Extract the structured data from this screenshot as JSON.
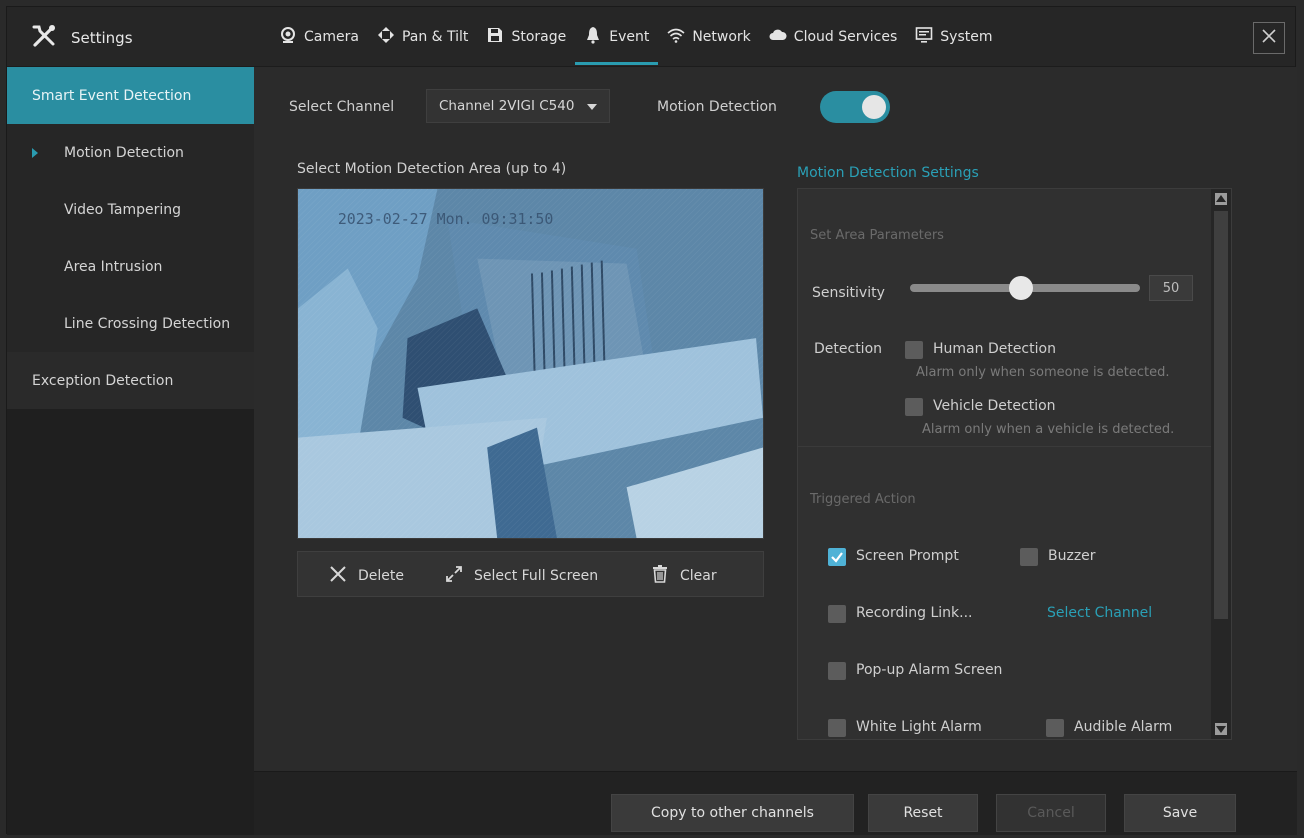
{
  "app": {
    "title": "Settings",
    "brand_icon": "tools-icon"
  },
  "tabs": [
    {
      "label": "Camera",
      "icon": "camera-lens-icon"
    },
    {
      "label": "Pan & Tilt",
      "icon": "pan-tilt-arrows-icon"
    },
    {
      "label": "Storage",
      "icon": "floppy-disk-icon"
    },
    {
      "label": "Event",
      "icon": "bell-icon",
      "active": true
    },
    {
      "label": "Network",
      "icon": "wifi-icon"
    },
    {
      "label": "Cloud Services",
      "icon": "cloud-icon"
    },
    {
      "label": "System",
      "icon": "monitor-icon"
    }
  ],
  "sidebar": {
    "items": [
      {
        "label": "Smart Event Detection"
      },
      {
        "label": "Motion Detection"
      },
      {
        "label": "Video Tampering"
      },
      {
        "label": "Area Intrusion"
      },
      {
        "label": "Line Crossing Detection"
      },
      {
        "label": "Exception Detection"
      }
    ]
  },
  "main": {
    "select_channel_label": "Select Channel",
    "channel_value": "Channel 2VIGI C540",
    "motion_detection_label": "Motion Detection",
    "motion_detection_enabled": true,
    "area_label": "Select Motion Detection Area (up to 4)",
    "video_timestamp": "2023-02-27 Mon. 09:31:50",
    "toolbar": {
      "delete": "Delete",
      "full_screen": "Select Full Screen",
      "clear": "Clear"
    }
  },
  "settings": {
    "title": "Motion Detection Settings",
    "area_params": "Set Area Parameters",
    "sensitivity_label": "Sensitivity",
    "sensitivity_value": "50",
    "detection_label": "Detection",
    "human_detection": "Human Detection",
    "human_hint": "Alarm only when someone is detected.",
    "vehicle_detection": "Vehicle Detection",
    "vehicle_hint": "Alarm only when a vehicle is detected.",
    "triggered_action": "Triggered Action",
    "screen_prompt": "Screen Prompt",
    "screen_prompt_checked": true,
    "buzzer": "Buzzer",
    "recording_link": "Recording Link...",
    "select_channel_link": "Select Channel",
    "popup_alarm": "Pop-up Alarm Screen",
    "white_light": "White Light Alarm",
    "audible_alarm": "Audible Alarm"
  },
  "footer": {
    "copy": "Copy to other channels",
    "reset": "Reset",
    "cancel": "Cancel",
    "save": "Save"
  },
  "colors": {
    "accent": "#2a8ea1",
    "accent_text": "#2aa0b6",
    "checkbox_checked": "#4fb2d6"
  }
}
